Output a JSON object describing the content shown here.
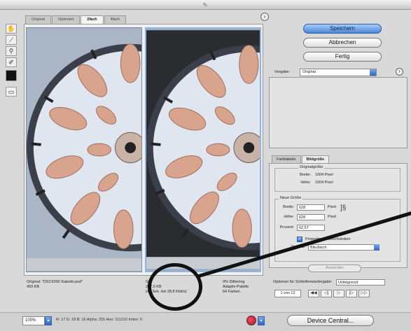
{
  "title_bar": {
    "icon": "app-icon"
  },
  "preview_tabs": [
    {
      "label": "Original",
      "active": false
    },
    {
      "label": "Optimiert",
      "active": false
    },
    {
      "label": "2fach",
      "active": true
    },
    {
      "label": "4fach",
      "active": false
    }
  ],
  "tools": [
    "hand-tool-icon",
    "slice-select-icon",
    "zoom-icon",
    "eyedropper-icon",
    "color-swatch-icon",
    "toggle-slices-icon"
  ],
  "info": {
    "left": {
      "line1": "Original: \"DSC6392 Kaleido.psd\"",
      "line2": "493 KB"
    },
    "mid": {
      "line1": "GIF",
      "line2": "237,5 KB",
      "line3": "(44 Sek. bei 28,8 Kbit/s)"
    },
    "right": {
      "line1": "0% Dithering",
      "line2": "Adaptiv-Palette",
      "line3": "64 Farben"
    }
  },
  "bottom_bar": {
    "zoom": "100%",
    "readout": "R: 17   G: 18   B: 16   Alpha: 255   Hex: 111210   Index: 0",
    "device_central_label": "Device Central..."
  },
  "buttons": {
    "save": "Speichern",
    "cancel": "Abbrechen",
    "done": "Fertig"
  },
  "preset": {
    "label": "Vorgabe:",
    "value": "Original"
  },
  "panel_tabs": [
    {
      "label": "Farbtabelle",
      "active": false
    },
    {
      "label": "Bildgröße",
      "active": true
    }
  ],
  "original_size": {
    "legend": "Originalgröße",
    "width_label": "Breite:",
    "width_value": "1004 Pixel",
    "height_label": "Höhe:",
    "height_value": "1004 Pixel"
  },
  "new_size": {
    "legend": "Neue Größe",
    "width_label": "Breite:",
    "width_value": "628",
    "width_unit": "Pixel",
    "height_label": "Höhe:",
    "height_value": "628",
    "height_unit": "Pixel",
    "percent_label": "Prozent:",
    "percent_value": "62,57",
    "constrain_label": "Proportionen beschränken",
    "quality_label": "Qualität:",
    "quality_value": "Bikubisch"
  },
  "apply_label": "Anwenden",
  "animation": {
    "label": "Optionen für Schleifenwiedergabe:",
    "loop_value": "Unbegrenzt",
    "frames": "1 von 12"
  },
  "player_buttons": [
    "first-frame-icon",
    "prev-frame-icon",
    "play-icon",
    "next-frame-icon",
    "last-frame-icon"
  ]
}
